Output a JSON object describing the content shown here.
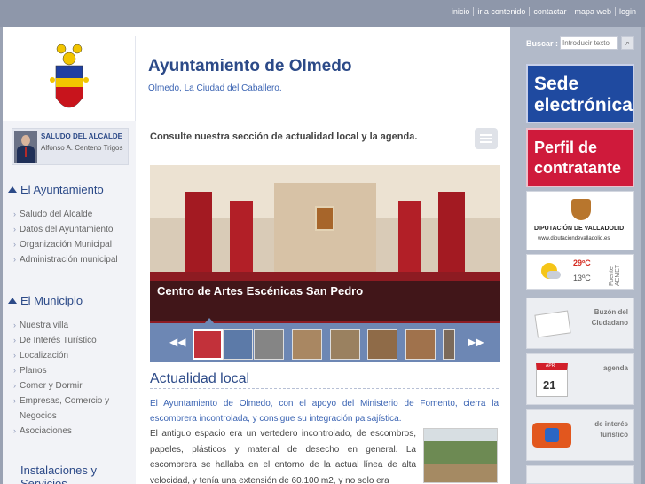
{
  "top_links": [
    "inicio",
    "ir a contenido",
    "contactar",
    "mapa web",
    "login"
  ],
  "header": {
    "title": "Ayuntamiento de Olmedo",
    "subtitle": "Olmedo, La Ciudad del Caballero."
  },
  "alcalde": {
    "title": "SALUDO DEL ALCALDE",
    "name": "Alfonso A. Centeno Trigos"
  },
  "sidebar": {
    "section1": {
      "title": "El Ayuntamiento",
      "items": [
        "Saludo del Alcalde",
        "Datos del Ayuntamiento",
        "Organización Municipal",
        "Administración municipal"
      ]
    },
    "section2": {
      "title": "El Municipio",
      "items": [
        "Nuestra villa",
        "De Interés Turístico",
        "Localización",
        "Planos",
        "Comer y Dormir",
        "Empresas, Comercio y",
        "Negocios",
        "Asociaciones"
      ]
    },
    "section3": {
      "title": "Instalaciones y",
      "title2": "Servicios"
    }
  },
  "main": {
    "consulte": "Consulte nuestra sección de actualidad local y la agenda.",
    "slider_caption": "Centro de Artes Escénicas San Pedro",
    "actualidad_title": "Actualidad local",
    "lead": "El Ayuntamiento de Olmedo, con el apoyo del Ministerio de Fomento, cierra la escombrera incontrolada, y consigue su integración paisajística.",
    "body": "El antiguo espacio era un vertedero incontrolado, de escombros, papeles, plásticos y material de desecho en general. La escombrera se hallaba en el entorno de la actual línea de alta velocidad, y tenía una extensión de 60.100 m2, y no solo era"
  },
  "search": {
    "label": "Buscar :",
    "placeholder": "Introducir texto"
  },
  "right": {
    "sede_1": "Sede",
    "sede_2": "electrónica",
    "perfil_1": "Perfil de",
    "perfil_2": "contratante",
    "dipu_name": "DIPUTACIÓN DE VALLADOLID",
    "dipu_web": "www.diputaciondevalladolid.es",
    "temp_high": "29ºC",
    "temp_low": "13ºC",
    "temp_source": "Fuente AEMET",
    "buzon": "Buzón del Ciudadano",
    "agenda": "agenda",
    "agenda_month": "APR",
    "agenda_day": "21",
    "turismo": "de interés turístico"
  },
  "colors": {
    "brand_blue": "#2c4a88",
    "link_blue": "#3b64b3",
    "sede_bg": "#1f4aa0",
    "perfil_bg": "#cf1a3b"
  }
}
